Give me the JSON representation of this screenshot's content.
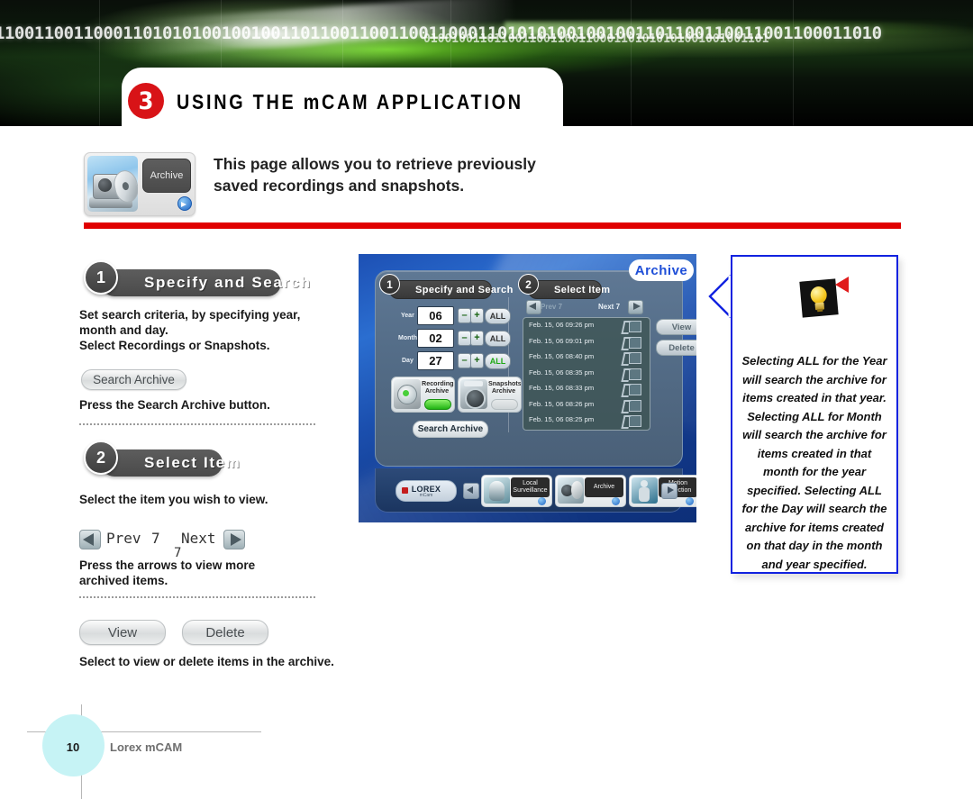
{
  "banner": {
    "binary_row_1": "110011001100011010101001001001101100110011001100011010101001001001101100110011001100011010",
    "binary_row_2": "0100100110110011001100110001101010101001001001101",
    "chapter_number": "3",
    "chapter_title": "USING THE mCAM APPLICATION"
  },
  "intro": {
    "icon_label": "Archive",
    "icon_name": "archive-thumbnail",
    "description_line_1": "This page allows you to retrieve previously",
    "description_line_2": "saved recordings and snapshots.",
    "rule_color": "#e00000"
  },
  "steps": [
    {
      "number": "1",
      "title": "Specify and Search",
      "body_line_1": "Set search criteria, by specifying year,",
      "body_line_2": "month and day.",
      "body_line_3": "Select Recordings or Snapshots.",
      "button_label": "Search Archive",
      "button_caption": "Press the Search Archive button."
    },
    {
      "number": "2",
      "title": "Select Item",
      "body_line_1": "Select the item you wish to view.",
      "prev_label": "Prev",
      "prev_count": "7",
      "next_label": "Next",
      "next_count": "7",
      "caption_line_1": "Press the arrows to view more",
      "caption_line_2": "archived items."
    }
  ],
  "action_buttons": {
    "view_label": "View",
    "delete_label": "Delete",
    "caption": "Select to view or delete items in the archive."
  },
  "device": {
    "page_tab": "Archive",
    "panel_1": {
      "number": "1",
      "title": "Specify and Search"
    },
    "panel_2": {
      "number": "2",
      "title": "Select Item"
    },
    "fields": [
      {
        "label": "Year",
        "value": "06",
        "minus": "–",
        "plus": "+",
        "all_label": "ALL",
        "all_active": false
      },
      {
        "label": "Month",
        "value": "02",
        "minus": "–",
        "plus": "+",
        "all_label": "ALL",
        "all_active": false
      },
      {
        "label": "Day",
        "value": "27",
        "minus": "–",
        "plus": "+",
        "all_label": "ALL",
        "all_active": true
      }
    ],
    "archive_toggles": [
      {
        "line1": "Recordings",
        "line2": "Archive",
        "active": true
      },
      {
        "line1": "Snapshots",
        "line2": "Archive",
        "active": false
      }
    ],
    "search_button": "Search Archive",
    "pager": {
      "prev": "Prev 7",
      "next": "Next 7"
    },
    "list_items": [
      "Feb. 15, 06 09:26 pm",
      "Feb. 15, 06 09:01 pm",
      "Feb. 15, 06 08:40 pm",
      "Feb. 15, 06 08:35 pm",
      "Feb. 15, 06 08:33 pm",
      "Feb. 15, 06 08:26 pm",
      "Feb. 15, 06 08:25 pm"
    ],
    "side_buttons": {
      "view": "View",
      "delete": "Delete"
    },
    "brand": {
      "name": "LOREX",
      "sub": "mCam"
    },
    "nav_buttons": [
      {
        "line1": "Local",
        "line2": "Surveillance"
      },
      {
        "line1": "Archive",
        "line2": ""
      },
      {
        "line1": "Motion",
        "line2": "Detection"
      }
    ]
  },
  "callout": {
    "icon": "lightbulb-icon",
    "text": "Selecting ALL for the Year will search the archive for items created in that year. Selecting ALL for Month will search the archive for items created in that month for the year specified. Selecting ALL for the Day will search the archive for items created on that day in the month and year specified.",
    "border_color": "#1122e0"
  },
  "footer": {
    "page_number": "10",
    "product_name": "Lorex mCAM"
  }
}
